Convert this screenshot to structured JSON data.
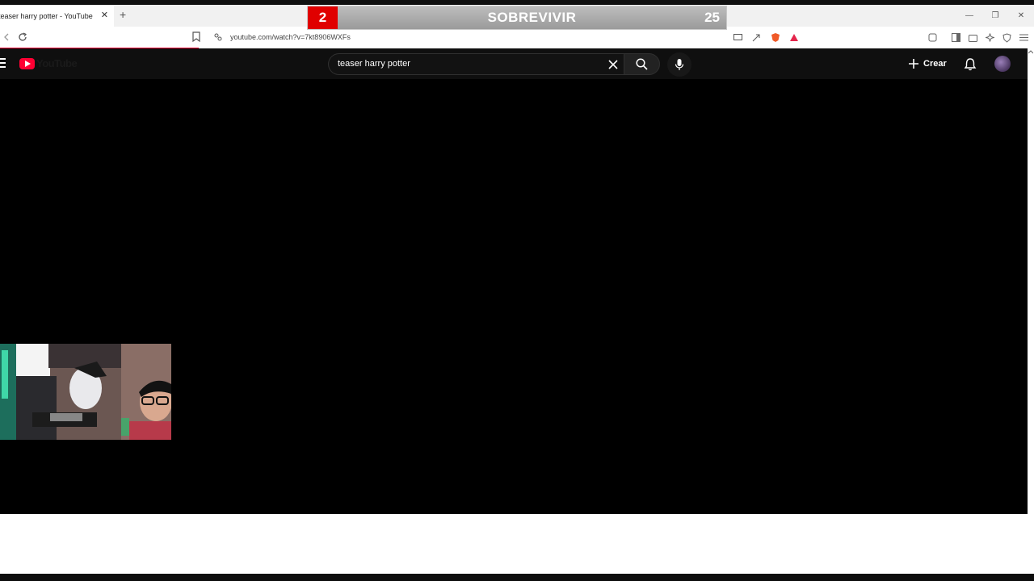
{
  "browser": {
    "tab_title": "teaser harry potter - YouTube",
    "tab_close": "✕",
    "new_tab": "+",
    "url": "youtube.com/watch?v=7kt8906WXFs",
    "window_controls": [
      "—",
      "❐",
      "✕"
    ]
  },
  "overlay": {
    "round": "2",
    "title": "SOBREVIVIR",
    "score": "25",
    "colors": {
      "round_bg": "#e00000",
      "bar_bg": "#a8a8a8"
    }
  },
  "youtube": {
    "logo_text": "YouTube",
    "search": {
      "value": "teaser harry potter"
    },
    "create_label": "Crear",
    "colors": {
      "accent": "#ff0033",
      "header_bg": "#0f0f0f"
    }
  },
  "icons": {
    "back": "back-icon",
    "reload": "reload-icon",
    "bookmark": "bookmark-icon",
    "site_settings": "site-settings-icon",
    "search": "search-icon",
    "mic": "mic-icon",
    "bell": "bell-icon",
    "clear": "clear-icon",
    "menu": "menu-icon"
  }
}
